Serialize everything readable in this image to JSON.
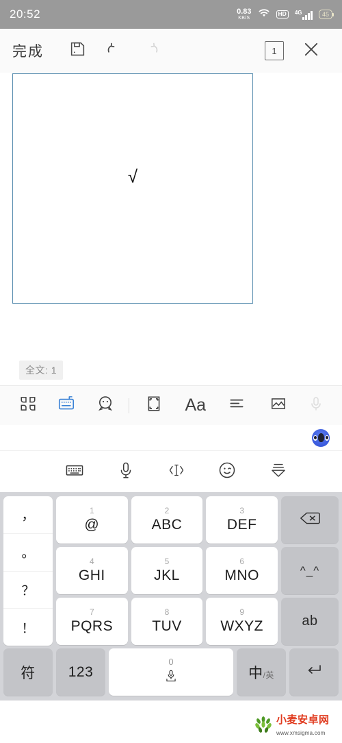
{
  "status_bar": {
    "time": "20:52",
    "net_speed_value": "0.83",
    "net_speed_unit": "KB/S",
    "wifi_icon": "wifi-icon",
    "hd_label": "HD",
    "network_label": "4G",
    "battery_level": "45"
  },
  "toolbar": {
    "done_label": "完成",
    "save_icon": "save-icon",
    "undo_icon": "undo-icon",
    "redo_icon": "redo-icon",
    "page_count": "1",
    "close_icon": "close-icon"
  },
  "document": {
    "content_mark": "√",
    "word_count_label": "全文: 1",
    "page_border_color": "#5b8fb0"
  },
  "edit_bar": {
    "items": [
      {
        "icon": "apps-grid-icon",
        "active": false
      },
      {
        "icon": "keyboard-input-icon",
        "active": true
      },
      {
        "icon": "emoji-face-icon",
        "active": false
      },
      {
        "icon": "crop-frame-icon",
        "active": false
      },
      {
        "icon": "font-size-icon",
        "label": "Aa",
        "active": false
      },
      {
        "icon": "align-left-icon",
        "active": false
      },
      {
        "icon": "image-icon",
        "active": false
      },
      {
        "icon": "microphone-icon",
        "active": false,
        "disabled": true
      }
    ]
  },
  "ime": {
    "mascot_icon": "ime-mascot-icon",
    "function_row": [
      {
        "icon": "keyboard-switch-icon"
      },
      {
        "icon": "microphone-icon"
      },
      {
        "icon": "text-cursor-icon"
      },
      {
        "icon": "emoji-wink-icon"
      },
      {
        "icon": "collapse-keyboard-icon"
      }
    ],
    "punctuation_keys": [
      "，",
      "。",
      "？",
      "！"
    ],
    "rows": [
      [
        {
          "num": "1",
          "label": "@"
        },
        {
          "num": "2",
          "label": "ABC"
        },
        {
          "num": "3",
          "label": "DEF"
        },
        {
          "icon": "backspace-icon",
          "type": "function"
        }
      ],
      [
        {
          "num": "4",
          "label": "GHI"
        },
        {
          "num": "5",
          "label": "JKL"
        },
        {
          "num": "6",
          "label": "MNO"
        },
        {
          "label": "^_^",
          "type": "function"
        }
      ],
      [
        {
          "num": "7",
          "label": "PQRS"
        },
        {
          "num": "8",
          "label": "TUV"
        },
        {
          "num": "9",
          "label": "WXYZ"
        },
        {
          "label": "ab",
          "type": "function"
        }
      ]
    ],
    "bottom_row": {
      "symbol_key": "符",
      "numeric_key": "123",
      "space_num": "0",
      "space_icon": "microphone-icon",
      "lang_key_main": "中",
      "lang_key_sub": "/英",
      "enter_icon": "enter-icon"
    }
  },
  "watermark": {
    "site_name": "小麦安卓网",
    "url": "www.xmsigma.com",
    "logo_icon": "wheat-logo-icon"
  }
}
